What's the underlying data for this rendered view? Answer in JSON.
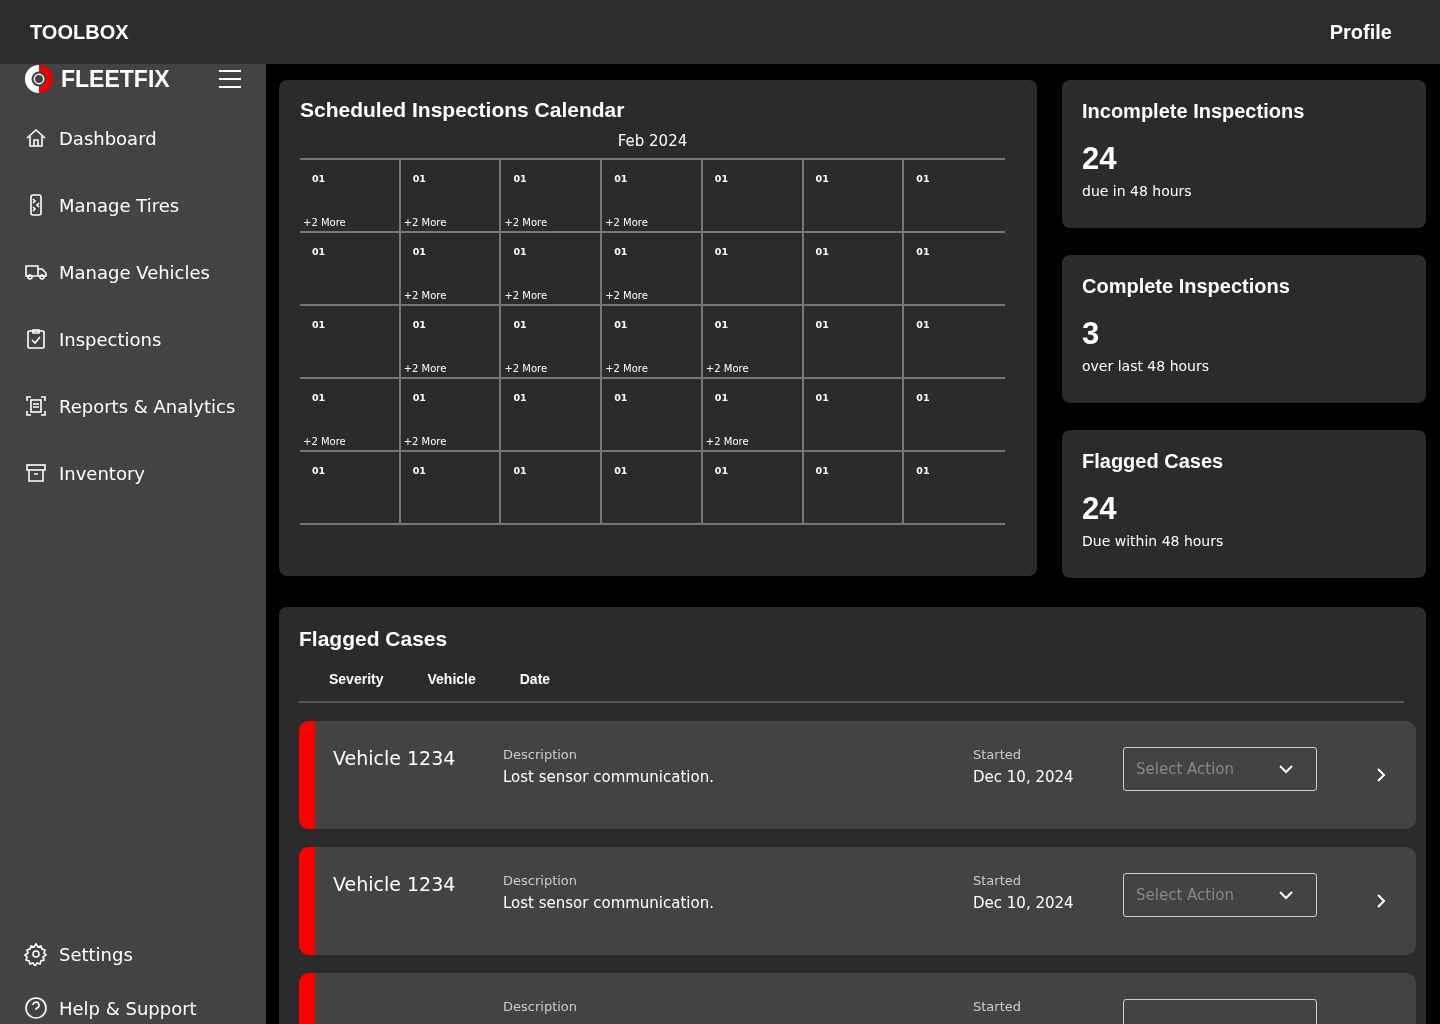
{
  "topbar": {
    "title": "TOOLBOX",
    "profile": "Profile"
  },
  "sidebar": {
    "brand": "FLEETFIX",
    "items": [
      {
        "label": "Dashboard"
      },
      {
        "label": "Manage Tires"
      },
      {
        "label": "Manage Vehicles"
      },
      {
        "label": "Inspections"
      },
      {
        "label": "Reports & Analytics"
      },
      {
        "label": "Inventory"
      }
    ],
    "bottom_items": [
      {
        "label": "Settings"
      },
      {
        "label": "Help & Support"
      }
    ]
  },
  "calendar": {
    "title": "Scheduled Inspections Calendar",
    "month": "Feb 2024",
    "weeks": [
      [
        {
          "day": "01",
          "more": "+2 More"
        },
        {
          "day": "01",
          "more": "+2 More"
        },
        {
          "day": "01",
          "more": "+2 More"
        },
        {
          "day": "01",
          "more": "+2 More"
        },
        {
          "day": "01"
        },
        {
          "day": "01"
        },
        {
          "day": "01"
        }
      ],
      [
        {
          "day": "01"
        },
        {
          "day": "01",
          "more": "+2 More"
        },
        {
          "day": "01",
          "more": "+2 More"
        },
        {
          "day": "01",
          "more": "+2 More"
        },
        {
          "day": "01"
        },
        {
          "day": "01"
        },
        {
          "day": "01"
        }
      ],
      [
        {
          "day": "01"
        },
        {
          "day": "01",
          "more": "+2 More"
        },
        {
          "day": "01",
          "more": "+2 More"
        },
        {
          "day": "01",
          "more": "+2 More"
        },
        {
          "day": "01",
          "more": "+2 More"
        },
        {
          "day": "01"
        },
        {
          "day": "01"
        }
      ],
      [
        {
          "day": "01",
          "more": "+2 More"
        },
        {
          "day": "01",
          "more": "+2 More"
        },
        {
          "day": "01"
        },
        {
          "day": "01"
        },
        {
          "day": "01",
          "more": "+2 More"
        },
        {
          "day": "01"
        },
        {
          "day": "01"
        }
      ],
      [
        {
          "day": "01"
        },
        {
          "day": "01"
        },
        {
          "day": "01"
        },
        {
          "day": "01"
        },
        {
          "day": "01"
        },
        {
          "day": "01"
        },
        {
          "day": "01"
        }
      ]
    ]
  },
  "stats": [
    {
      "title": "Incomplete Inspections",
      "value": "24",
      "caption": "due in 48 hours"
    },
    {
      "title": "Complete Inspections",
      "value": "3",
      "caption": "over last 48 hours"
    },
    {
      "title": "Flagged Cases",
      "value": "24",
      "caption": "Due within 48 hours"
    }
  ],
  "flagged": {
    "title": "Flagged Cases",
    "columns": [
      "Severity",
      "Vehicle",
      "Date"
    ],
    "rows": [
      {
        "color": "#ff0000",
        "vehicle": "Vehicle 1234",
        "description_label": "Description",
        "description": "Lost sensor communication.",
        "started_label": "Started",
        "date": "Dec 10, 2024",
        "action": {
          "placeholder": "Select Action"
        }
      },
      {
        "color": "#ff0000",
        "vehicle": "Vehicle 1234",
        "description_label": "Description",
        "description": "Lost sensor communication.",
        "started_label": "Started",
        "date": "Dec 10, 2024",
        "action": {
          "placeholder": "Select Action"
        }
      },
      {
        "color": "#ff0000",
        "description_label": "Description",
        "started_label": "Started",
        "action": {}
      }
    ]
  }
}
